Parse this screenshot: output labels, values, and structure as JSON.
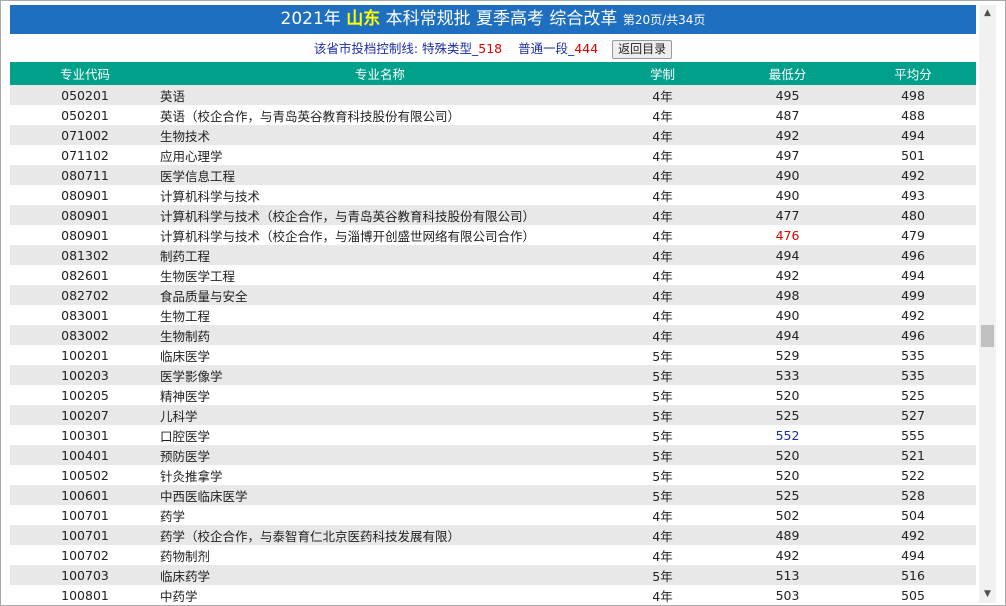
{
  "header": {
    "year": "2021年",
    "province": "山东",
    "batch": "本科常规批 夏季高考 综合改革",
    "page_info": "第20页/共34页"
  },
  "control_line": {
    "label": "该省市投档控制线:",
    "special_label": "特殊类型_",
    "special_value": "518",
    "normal_label": "普通一段_",
    "normal_value": "444",
    "back_button": "返回目录"
  },
  "table": {
    "columns": {
      "code": "专业代码",
      "name": "专业名称",
      "years": "学制",
      "min": "最低分",
      "avg": "平均分"
    },
    "rows": [
      {
        "code": "050201",
        "name": "英语",
        "years": "4年",
        "min": "495",
        "avg": "498"
      },
      {
        "code": "050201",
        "name": "英语（校企合作，与青岛英谷教育科技股份有限公司）",
        "years": "4年",
        "min": "487",
        "avg": "488"
      },
      {
        "code": "071002",
        "name": "生物技术",
        "years": "4年",
        "min": "492",
        "avg": "494"
      },
      {
        "code": "071102",
        "name": "应用心理学",
        "years": "4年",
        "min": "497",
        "avg": "501"
      },
      {
        "code": "080711",
        "name": "医学信息工程",
        "years": "4年",
        "min": "490",
        "avg": "492"
      },
      {
        "code": "080901",
        "name": "计算机科学与技术",
        "years": "4年",
        "min": "490",
        "avg": "493"
      },
      {
        "code": "080901",
        "name": "计算机科学与技术（校企合作，与青岛英谷教育科技股份有限公司）",
        "years": "4年",
        "min": "477",
        "avg": "480"
      },
      {
        "code": "080901",
        "name": "计算机科学与技术（校企合作，与淄博开创盛世网络有限公司合作）",
        "years": "4年",
        "min": "476",
        "avg": "479",
        "min_color": "red"
      },
      {
        "code": "081302",
        "name": "制药工程",
        "years": "4年",
        "min": "494",
        "avg": "496"
      },
      {
        "code": "082601",
        "name": "生物医学工程",
        "years": "4年",
        "min": "492",
        "avg": "494"
      },
      {
        "code": "082702",
        "name": "食品质量与安全",
        "years": "4年",
        "min": "498",
        "avg": "499"
      },
      {
        "code": "083001",
        "name": "生物工程",
        "years": "4年",
        "min": "490",
        "avg": "492"
      },
      {
        "code": "083002",
        "name": "生物制药",
        "years": "4年",
        "min": "494",
        "avg": "496"
      },
      {
        "code": "100201",
        "name": "临床医学",
        "years": "5年",
        "min": "529",
        "avg": "535"
      },
      {
        "code": "100203",
        "name": "医学影像学",
        "years": "5年",
        "min": "533",
        "avg": "535"
      },
      {
        "code": "100205",
        "name": "精神医学",
        "years": "5年",
        "min": "520",
        "avg": "525"
      },
      {
        "code": "100207",
        "name": "儿科学",
        "years": "5年",
        "min": "525",
        "avg": "527"
      },
      {
        "code": "100301",
        "name": "口腔医学",
        "years": "5年",
        "min": "552",
        "avg": "555",
        "min_color": "blue"
      },
      {
        "code": "100401",
        "name": "预防医学",
        "years": "5年",
        "min": "520",
        "avg": "521"
      },
      {
        "code": "100502",
        "name": "针灸推拿学",
        "years": "5年",
        "min": "520",
        "avg": "522"
      },
      {
        "code": "100601",
        "name": "中西医临床医学",
        "years": "5年",
        "min": "525",
        "avg": "528"
      },
      {
        "code": "100701",
        "name": "药学",
        "years": "4年",
        "min": "502",
        "avg": "504"
      },
      {
        "code": "100701",
        "name": "药学（校企合作，与泰智育仁北京医药科技发展有限）",
        "years": "4年",
        "min": "489",
        "avg": "492"
      },
      {
        "code": "100702",
        "name": "药物制剂",
        "years": "4年",
        "min": "492",
        "avg": "494"
      },
      {
        "code": "100703",
        "name": "临床药学",
        "years": "5年",
        "min": "513",
        "avg": "516"
      },
      {
        "code": "100801",
        "name": "中药学",
        "years": "4年",
        "min": "503",
        "avg": "505"
      }
    ]
  },
  "scrollbar": {
    "up_icon": "chevron-up-icon",
    "down_icon": "chevron-down-icon"
  },
  "colors": {
    "title_bg": "#1e6fbf",
    "header_bg": "#00a08a",
    "province": "#ffff00",
    "red": "#e00000",
    "blue": "#1d2fa8"
  }
}
